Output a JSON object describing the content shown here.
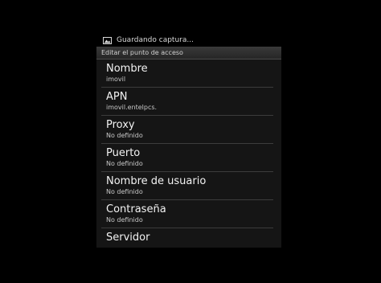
{
  "status_bar": {
    "icon": "image-icon",
    "text": "Guardando captura..."
  },
  "header": {
    "title": "Editar el punto de acceso"
  },
  "preferences": [
    {
      "title": "Nombre",
      "summary": "imovil"
    },
    {
      "title": "APN",
      "summary": "imovil.entelpcs."
    },
    {
      "title": "Proxy",
      "summary": "No definido"
    },
    {
      "title": "Puerto",
      "summary": "No definido"
    },
    {
      "title": "Nombre de usuario",
      "summary": "No definido"
    },
    {
      "title": "Contraseña",
      "summary": "No definido"
    },
    {
      "title": "Servidor",
      "summary": ""
    }
  ]
}
